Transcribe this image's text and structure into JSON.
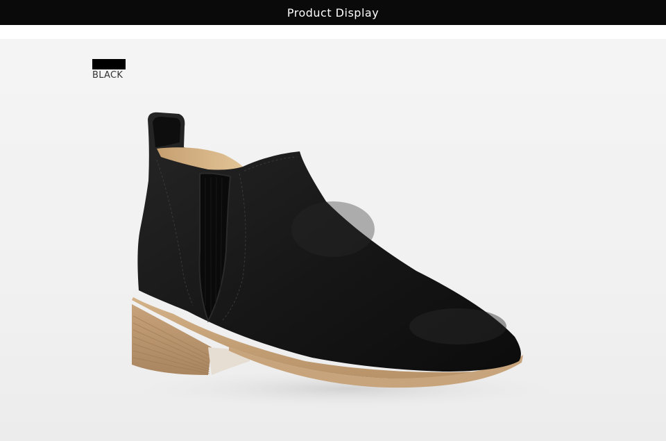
{
  "header": {
    "title": "Product Display"
  },
  "product": {
    "color_label": "BLACK",
    "colors": {
      "header_bg": "#0a0a0a",
      "swatch": "#000000",
      "boot_suede": "#1a1a1a",
      "sole_tan": "#c9a77a",
      "heel_wood": "#b8916a",
      "lining": "#d9b98c"
    }
  }
}
